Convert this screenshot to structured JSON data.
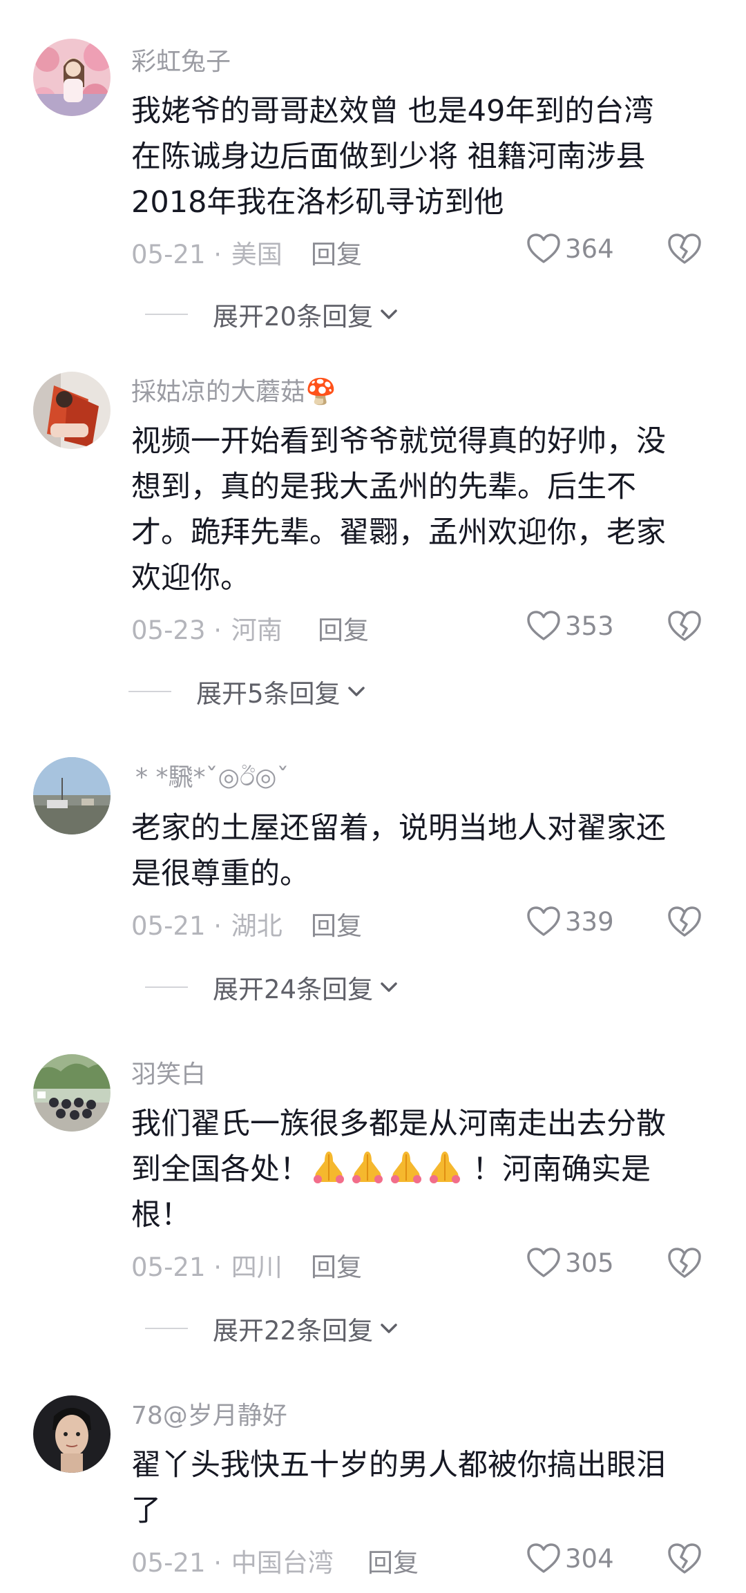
{
  "comments": [
    {
      "username": "彩虹兔子",
      "content_lines": [
        "我姥爷的哥哥赵效曾 也是49年到的台湾",
        "在陈诚身边后面做到少将 祖籍河南涉县",
        "2018年我在洛杉矶寻访到他"
      ],
      "date": "05-21 · ",
      "location": "美国",
      "reply_label": "回复",
      "likes": "364",
      "expand_label": "展开20条回复"
    },
    {
      "username": "採姑凉的大蘑菇🍄",
      "content_lines": [
        "视频一开始看到爷爷就觉得真的好帅，没",
        "想到，真的是我大孟州的先辈。后生不",
        "才。跪拜先辈。翟翾，孟州欢迎你，老家",
        "欢迎你。"
      ],
      "date": "05-23 · ",
      "location": "河南",
      "reply_label": "回复",
      "likes": "353",
      "expand_label": "展开5条回复"
    },
    {
      "username": "* *騛*ˇ◎ඊ◎ˇ",
      "content_lines": [
        "老家的土屋还留着，说明当地人对翟家还",
        "是很尊重的。"
      ],
      "date": "05-21 · ",
      "location": "湖北",
      "reply_label": "回复",
      "likes": "339",
      "expand_label": "展开24条回复"
    },
    {
      "username": "羽笑白",
      "content_lines": [
        "我们翟氏一族很多都是从河南走出去分散",
        "到全国各处！",
        "！河南确实是",
        "根！"
      ],
      "date": "05-21 · ",
      "location": "四川",
      "reply_label": "回复",
      "likes": "305",
      "expand_label": "展开22条回复"
    },
    {
      "username": "78@岁月静好",
      "content_lines": [
        "翟丫头我快五十岁的男人都被你搞出眼泪",
        "了"
      ],
      "date": "05-21 · ",
      "location": "中国台湾",
      "reply_label": "回复",
      "likes": "304"
    }
  ],
  "icons": {
    "like": "heart-outline-icon",
    "dislike": "broken-heart-icon",
    "expand": "chevron-down-icon",
    "emoji": "folded-hands-emoji"
  },
  "colors": {
    "text": "#161823",
    "muted": "#9b9ca3",
    "meta": "#b4b5bb",
    "emoji": "#f5b82e"
  }
}
